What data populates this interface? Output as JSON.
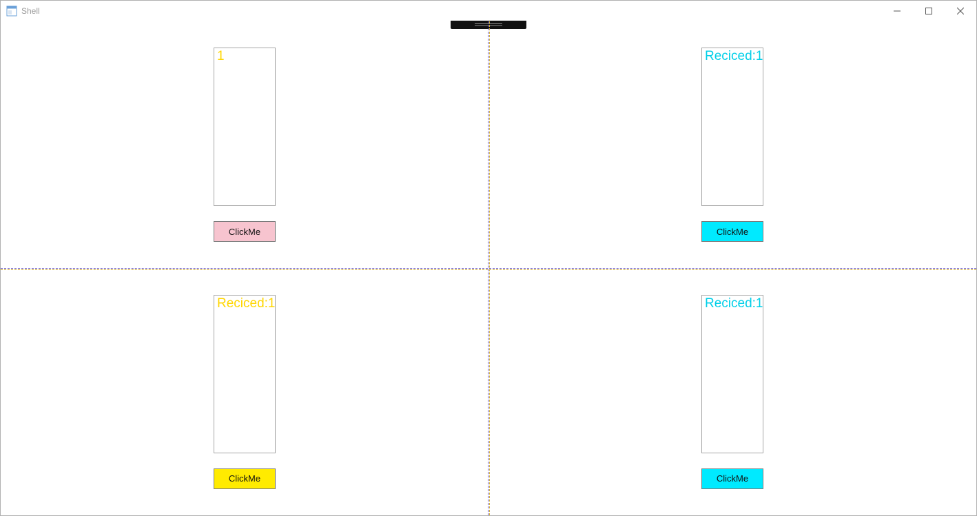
{
  "window": {
    "title": "Shell"
  },
  "colors": {
    "pink": "#f7c4cf",
    "yellow_text": "#ffd600",
    "yellow_bg": "#ffeb00",
    "cyan_text": "#00cfe8",
    "cyan_bg": "#00eaff"
  },
  "quadrants": {
    "q0": {
      "panel_text": "1",
      "button_label": "ClickMe"
    },
    "q1": {
      "panel_text": "Reciced:1",
      "button_label": "ClickMe"
    },
    "q2": {
      "panel_text": "Reciced:1",
      "button_label": "ClickMe"
    },
    "q3": {
      "panel_text": "Reciced:1",
      "button_label": "ClickMe"
    }
  }
}
